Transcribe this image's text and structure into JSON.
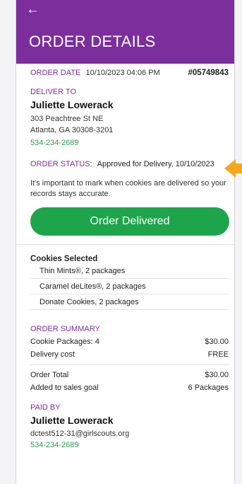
{
  "header": {
    "title": "ORDER DETAILS",
    "back_icon": "back-arrow-icon"
  },
  "order": {
    "date_label": "ORDER DATE",
    "date_value": "10/10/2023 04:06 PM",
    "number": "#05749843"
  },
  "deliver_to": {
    "label": "DELIVER TO",
    "name": "Juliette Lowerack",
    "street": "303 Peachtree St NE",
    "city": "Atlanta, GA 30308-3201",
    "phone": "534-234-2689"
  },
  "status": {
    "label": "ORDER STATUS:",
    "value": "Approved for Delivery, 10/10/2023"
  },
  "note": "It's important to mark when cookies are delivered so your records stays accurate.",
  "delivered_button": "Order Delivered",
  "cookies": {
    "title": "Cookies Selected",
    "items": [
      "Thin Mints®, 2 packages",
      "Caramel deLites®, 2 packages",
      "Donate Cookies, 2 packages"
    ]
  },
  "summary": {
    "title": "ORDER SUMMARY",
    "packages_label": "Cookie Packages: 4",
    "packages_value": "$30.00",
    "delivery_label": "Delivery cost",
    "delivery_value": "FREE",
    "total_label": "Order Total",
    "total_value": "$30.00",
    "goal_label": "Added to sales goal",
    "goal_value": "6 Packages"
  },
  "paid_by": {
    "label": "PAID BY",
    "name": "Juliette Lowerack",
    "email": "dctest512-31@girlscouts.org",
    "phone": "534-234-2689"
  },
  "colors": {
    "header": "#7b2e9c",
    "button": "#1ea54c",
    "phone_link": "#2f9a56",
    "annotation_arrow": "#f4a81d"
  }
}
